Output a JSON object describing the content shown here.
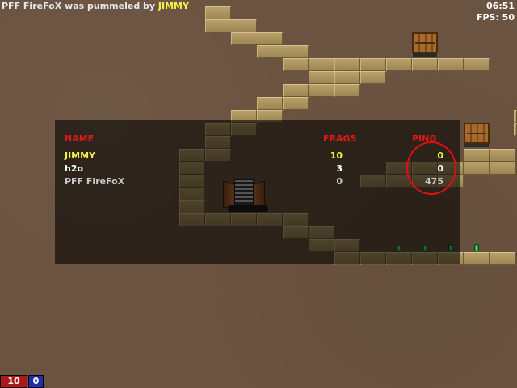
{
  "hud": {
    "kill_feed": {
      "victim": "PFF FireFoX",
      "verb": "was pummeled by",
      "killer": "JIMMY"
    },
    "clock": "06:51",
    "fps": "FPS: 50"
  },
  "scoreboard": {
    "headers": {
      "name": "NAME",
      "frags": "FRAGS",
      "ping": "PING"
    },
    "rows": [
      {
        "name": "JIMMY",
        "frags": "10",
        "ping": "0",
        "color": "#f2f24a"
      },
      {
        "name": "h2o",
        "frags": "3",
        "ping": "0",
        "color": "#ffffff"
      },
      {
        "name": "PFF FireFoX",
        "frags": "0",
        "ping": "475",
        "color": "#c8c8c8"
      }
    ]
  },
  "team_scores": {
    "red": "10",
    "blue": "0",
    "red_color": "#b01818",
    "blue_color": "#1e2fa8"
  },
  "colors": {
    "header_red": "#e01818",
    "annotation_circle": "#e01010"
  },
  "icons": [
    "crate-icon",
    "ammo-box-icon",
    "rocket-launcher-icon"
  ]
}
